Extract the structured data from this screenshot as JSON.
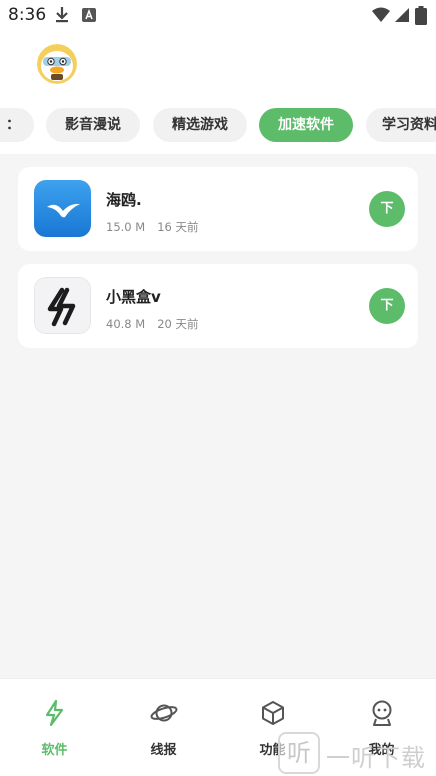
{
  "status_bar": {
    "time": "8:36",
    "icons": [
      "download-icon",
      "app-a-icon",
      "wifi-icon",
      "signal-icon",
      "battery-icon"
    ]
  },
  "header": {
    "avatar": "duck-avatar"
  },
  "tabs": [
    {
      "label": "：",
      "active": false
    },
    {
      "label": "影音漫说",
      "active": false
    },
    {
      "label": "精选游戏",
      "active": false
    },
    {
      "label": "加速软件",
      "active": true
    },
    {
      "label": "学习资料",
      "active": false
    }
  ],
  "apps": [
    {
      "name": "海鸥.",
      "size": "15.0 M",
      "age": "16 天前",
      "icon": "seagull-icon",
      "button": "下"
    },
    {
      "name": "小黑盒v",
      "size": "40.8 M",
      "age": "20 天前",
      "icon": "blackbox-lightning-icon",
      "button": "下"
    }
  ],
  "bottom_nav": [
    {
      "label": "软件",
      "icon": "lightning-icon",
      "active": true
    },
    {
      "label": "线报",
      "icon": "planet-icon",
      "active": false
    },
    {
      "label": "功能",
      "icon": "cube-icon",
      "active": false
    },
    {
      "label": "我的",
      "icon": "robot-icon",
      "active": false
    }
  ],
  "watermark": {
    "icon_char": "听",
    "text": "一听下载"
  },
  "colors": {
    "accent": "#5cbc6a",
    "background": "#f5f5f5",
    "card": "#ffffff"
  }
}
